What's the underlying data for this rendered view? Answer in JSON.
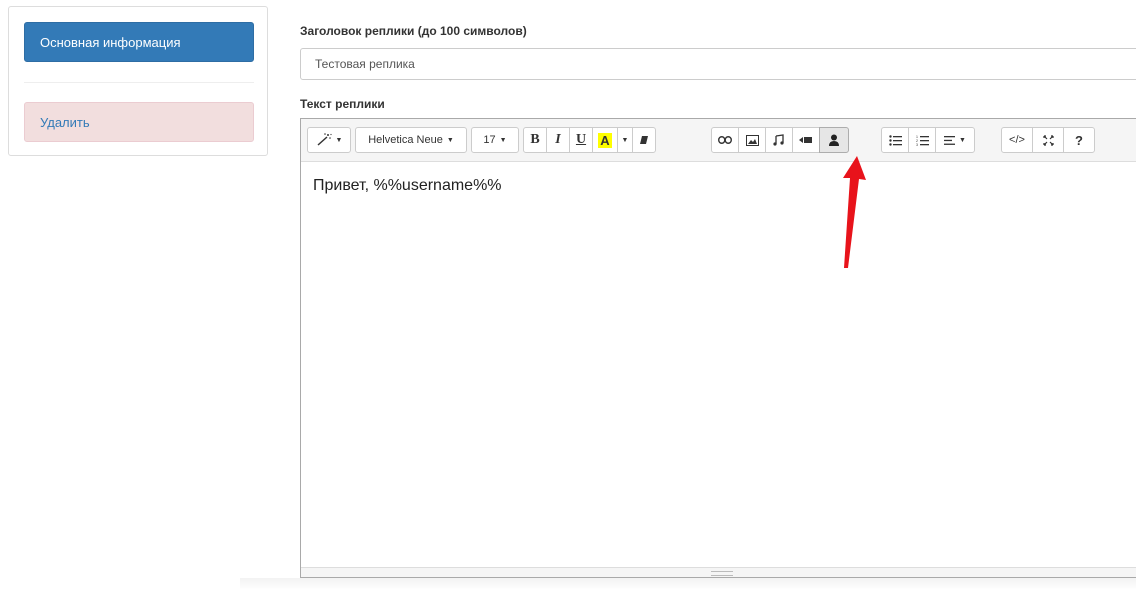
{
  "sidebar": {
    "primary_label": "Основная информация",
    "delete_label": "Удалить"
  },
  "form": {
    "title_label": "Заголовок реплики (до 100 символов)",
    "title_value": "Тестовая реплика",
    "text_label": "Текст реплики"
  },
  "toolbar": {
    "font_family": "Helvetica Neue",
    "font_size": "17",
    "bold": "B",
    "italic": "I",
    "underline": "U",
    "color": "A",
    "help": "?",
    "code": "</>"
  },
  "editor": {
    "content": "Привет, %%username%%"
  },
  "colors": {
    "primary": "#337ab7",
    "danger_bg": "#f2dede",
    "highlight_yellow": "#ffff00",
    "arrow_red": "#e8131b"
  }
}
